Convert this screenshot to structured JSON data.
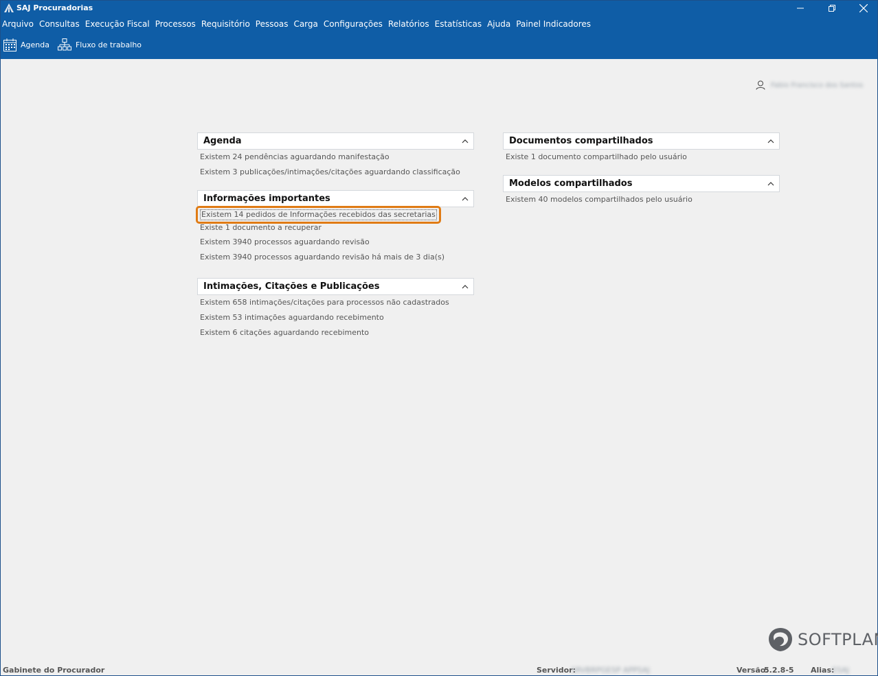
{
  "window": {
    "title": "SAJ Procuradorias"
  },
  "menu": [
    "Arquivo",
    "Consultas",
    "Execução Fiscal",
    "Processos",
    "Requisitório",
    "Pessoas",
    "Carga",
    "Configurações",
    "Relatórios",
    "Estatísticas",
    "Ajuda",
    "Painel Indicadores"
  ],
  "toolbar": {
    "agenda_label": "Agenda",
    "workflow_label": "Fluxo de trabalho"
  },
  "user": {
    "name": "Fabio Francisco dos Santos"
  },
  "panels": {
    "agenda": {
      "title": "Agenda",
      "lines": [
        "Existem  24 pendências aguardando manifestação",
        "Existem  3 publicações/intimações/citações aguardando classificação"
      ]
    },
    "info": {
      "title": "Informações importantes",
      "lines": [
        "Existem 14 pedidos de Informações recebidos das secretarias",
        "Existe 1 documento a recuperar",
        "Existem  3940 processos aguardando revisão",
        "Existem  3940 processos aguardando revisão há mais de 3 dia(s)"
      ]
    },
    "intimacoes": {
      "title": "Intimações, Citações e Publicações",
      "lines": [
        "Existem  658 intimações/citações para processos não cadastrados",
        "Existem  53 intimações aguardando recebimento",
        "Existem  6 citações aguardando recebimento"
      ]
    },
    "docs": {
      "title": "Documentos compartilhados",
      "lines": [
        "Existe 1 documento compartilhado pelo usuário"
      ]
    },
    "modelos": {
      "title": "Modelos compartilhados",
      "lines": [
        "Existem  40 modelos compartilhados pelo usuário"
      ]
    }
  },
  "status": {
    "location": "Gabinete do Procurador",
    "server_label": "Servidor:",
    "server_value": "SRVBRPGESP APPSAJ",
    "version_label": "Versão:",
    "version_value": "5.2.8-5",
    "alias_label": "Alias:",
    "alias_value": "ESAJ"
  },
  "brand": {
    "name": "SOFTPLAN"
  },
  "colors": {
    "header_blue": "#0f5da6",
    "focus_orange": "#e07b14"
  }
}
